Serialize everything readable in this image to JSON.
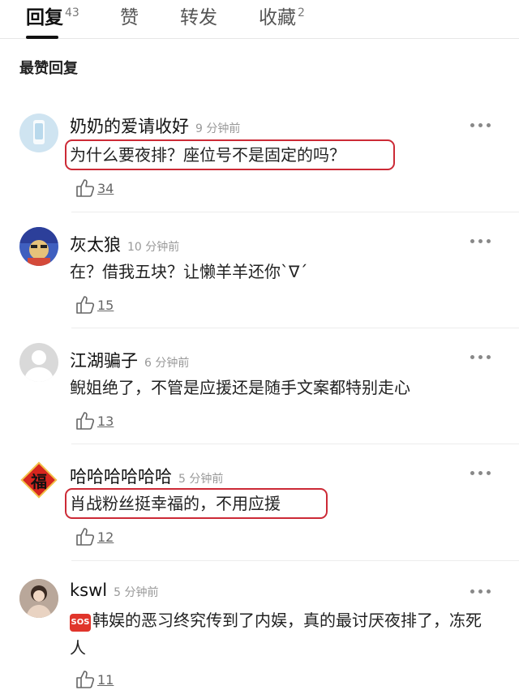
{
  "tabs": [
    {
      "label": "回复",
      "count": "43"
    },
    {
      "label": "赞",
      "count": ""
    },
    {
      "label": "转发",
      "count": ""
    },
    {
      "label": "收藏",
      "count": "2"
    }
  ],
  "section_title": "最赞回复",
  "comments": [
    {
      "name": "奶奶的爱请收好",
      "time": "9 分钟前",
      "text": "为什么要夜排？座位号不是固定的吗？",
      "likes": "34"
    },
    {
      "name": "灰太狼",
      "time": "10 分钟前",
      "text": "在？借我五块？让懒羊羊还你`∇´",
      "likes": "15"
    },
    {
      "name": "江湖骗子",
      "time": "6 分钟前",
      "text": "鲵姐绝了，不管是应援还是随手文案都特别走心",
      "likes": "13"
    },
    {
      "name": "哈哈哈哈哈哈",
      "time": "5 分钟前",
      "text": "肖战粉丝挺幸福的，不用应援",
      "likes": "12"
    },
    {
      "name": "kswl",
      "time": "5 分钟前",
      "badge": "SOS",
      "text": "韩娱的恶习终究传到了内娱，真的最讨厌夜排了，冻死人",
      "likes": "11"
    }
  ],
  "avatar_fu_char": "福",
  "colors": {
    "highlight": "#cc2a36",
    "badge": "#e0352b",
    "muted": "#999999"
  },
  "icons": {
    "more": "more-dots-icon",
    "like": "thumbs-up-icon"
  }
}
